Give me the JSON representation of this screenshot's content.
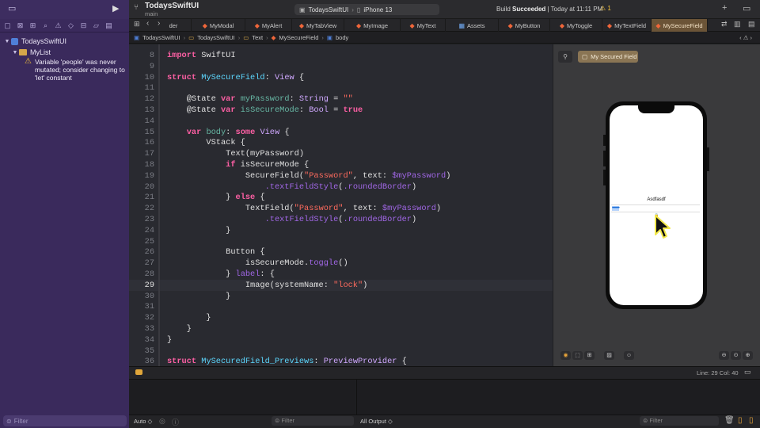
{
  "project": {
    "name": "TodaysSwiftUI",
    "branch": "main"
  },
  "scheme": {
    "name": "TodaysSwiftUI",
    "device": "iPhone 13"
  },
  "build_status": {
    "prefix": "Build",
    "result": "Succeeded",
    "time": "| Today at 11:11 PM",
    "warnings": "1"
  },
  "tabs": [
    {
      "label": "der",
      "active": false
    },
    {
      "label": "MyModal",
      "active": false
    },
    {
      "label": "MyAlert",
      "active": false
    },
    {
      "label": "MyTabView",
      "active": false
    },
    {
      "label": "MyImage",
      "active": false
    },
    {
      "label": "MyText",
      "active": false
    },
    {
      "label": "Assets",
      "active": false
    },
    {
      "label": "MyButton",
      "active": false
    },
    {
      "label": "MyToggle",
      "active": false
    },
    {
      "label": "MyTextField",
      "active": false
    },
    {
      "label": "MySecureField",
      "active": true
    }
  ],
  "breadcrumb": [
    "TodaysSwiftUI",
    "TodaysSwiftUI",
    "Text",
    "MySecureField",
    "body"
  ],
  "navigator": {
    "root": "TodaysSwiftUI",
    "child": "MyList",
    "warning": "Variable 'people' was never mutated; consider changing to 'let' constant",
    "filter_placeholder": "Filter"
  },
  "code_lines": [
    {
      "n": "8",
      "html": "<span class=\"k\">import</span> SwiftUI"
    },
    {
      "n": "9",
      "html": ""
    },
    {
      "n": "10",
      "html": "<span class=\"k\">struct</span> <span class=\"t\">MySecureField</span>: <span class=\"c\">View</span> {"
    },
    {
      "n": "11",
      "html": ""
    },
    {
      "n": "12",
      "html": "    @State <span class=\"k\">var</span> <span class=\"f\">myPassword</span>: <span class=\"c\">String</span> = <span class=\"s\">\"\"</span>"
    },
    {
      "n": "13",
      "html": "    @State <span class=\"k\">var</span> <span class=\"f\">isSecureMode</span>: <span class=\"c\">Bool</span> = <span class=\"k\">true</span>"
    },
    {
      "n": "14",
      "html": ""
    },
    {
      "n": "15",
      "html": "    <span class=\"k\">var</span> <span class=\"f\">body</span>: <span class=\"k\">some</span> <span class=\"c\">View</span> {"
    },
    {
      "n": "16",
      "html": "        VStack {"
    },
    {
      "n": "17",
      "html": "            Text(myPassword)"
    },
    {
      "n": "18",
      "html": "            <span class=\"k\">if</span> isSecureMode {"
    },
    {
      "n": "19",
      "html": "                SecureField(<span class=\"s\">\"Password\"</span>, text: <span class=\"p\">$myPassword</span>)"
    },
    {
      "n": "20",
      "html": "                    <span class=\"p\">.textFieldStyle</span>(<span class=\"p\">.roundedBorder</span>)"
    },
    {
      "n": "21",
      "html": "            } <span class=\"k\">else</span> {"
    },
    {
      "n": "22",
      "html": "                TextField(<span class=\"s\">\"Password\"</span>, text: <span class=\"p\">$myPassword</span>)"
    },
    {
      "n": "23",
      "html": "                    <span class=\"p\">.textFieldStyle</span>(<span class=\"p\">.roundedBorder</span>)"
    },
    {
      "n": "24",
      "html": "            }"
    },
    {
      "n": "25",
      "html": ""
    },
    {
      "n": "26",
      "html": "            Button {"
    },
    {
      "n": "27",
      "html": "                isSecureMode.<span class=\"p\">toggle</span>()"
    },
    {
      "n": "28",
      "html": "            } <span class=\"p\">label</span>: {"
    },
    {
      "n": "29",
      "html": "                Image(systemName: <span class=\"s\">\"lock\"</span>)",
      "current": true
    },
    {
      "n": "30",
      "html": "            }"
    },
    {
      "n": "31",
      "html": ""
    },
    {
      "n": "32",
      "html": "        }"
    },
    {
      "n": "33",
      "html": "    }"
    },
    {
      "n": "34",
      "html": "}"
    },
    {
      "n": "35",
      "html": ""
    },
    {
      "n": "36",
      "html": "<span class=\"k\">struct</span> <span class=\"t\">MySecuredField_Previews</span>: <span class=\"c\">PreviewProvider</span> {"
    }
  ],
  "preview": {
    "chip_label": "My Secured Field",
    "text_output": "Asdfasdf",
    "secure_dots": "••••••••"
  },
  "status": {
    "line_col": "Line: 29  Col: 40"
  },
  "debug": {
    "auto_label": "Auto ◇",
    "filter_placeholder": "Filter",
    "output_label": "All Output ◇"
  },
  "colors": {
    "sidebar": "#3a2a5c",
    "active_tab": "#6b5437",
    "editor_bg": "#292a30",
    "keyword": "#fc5fa3"
  }
}
